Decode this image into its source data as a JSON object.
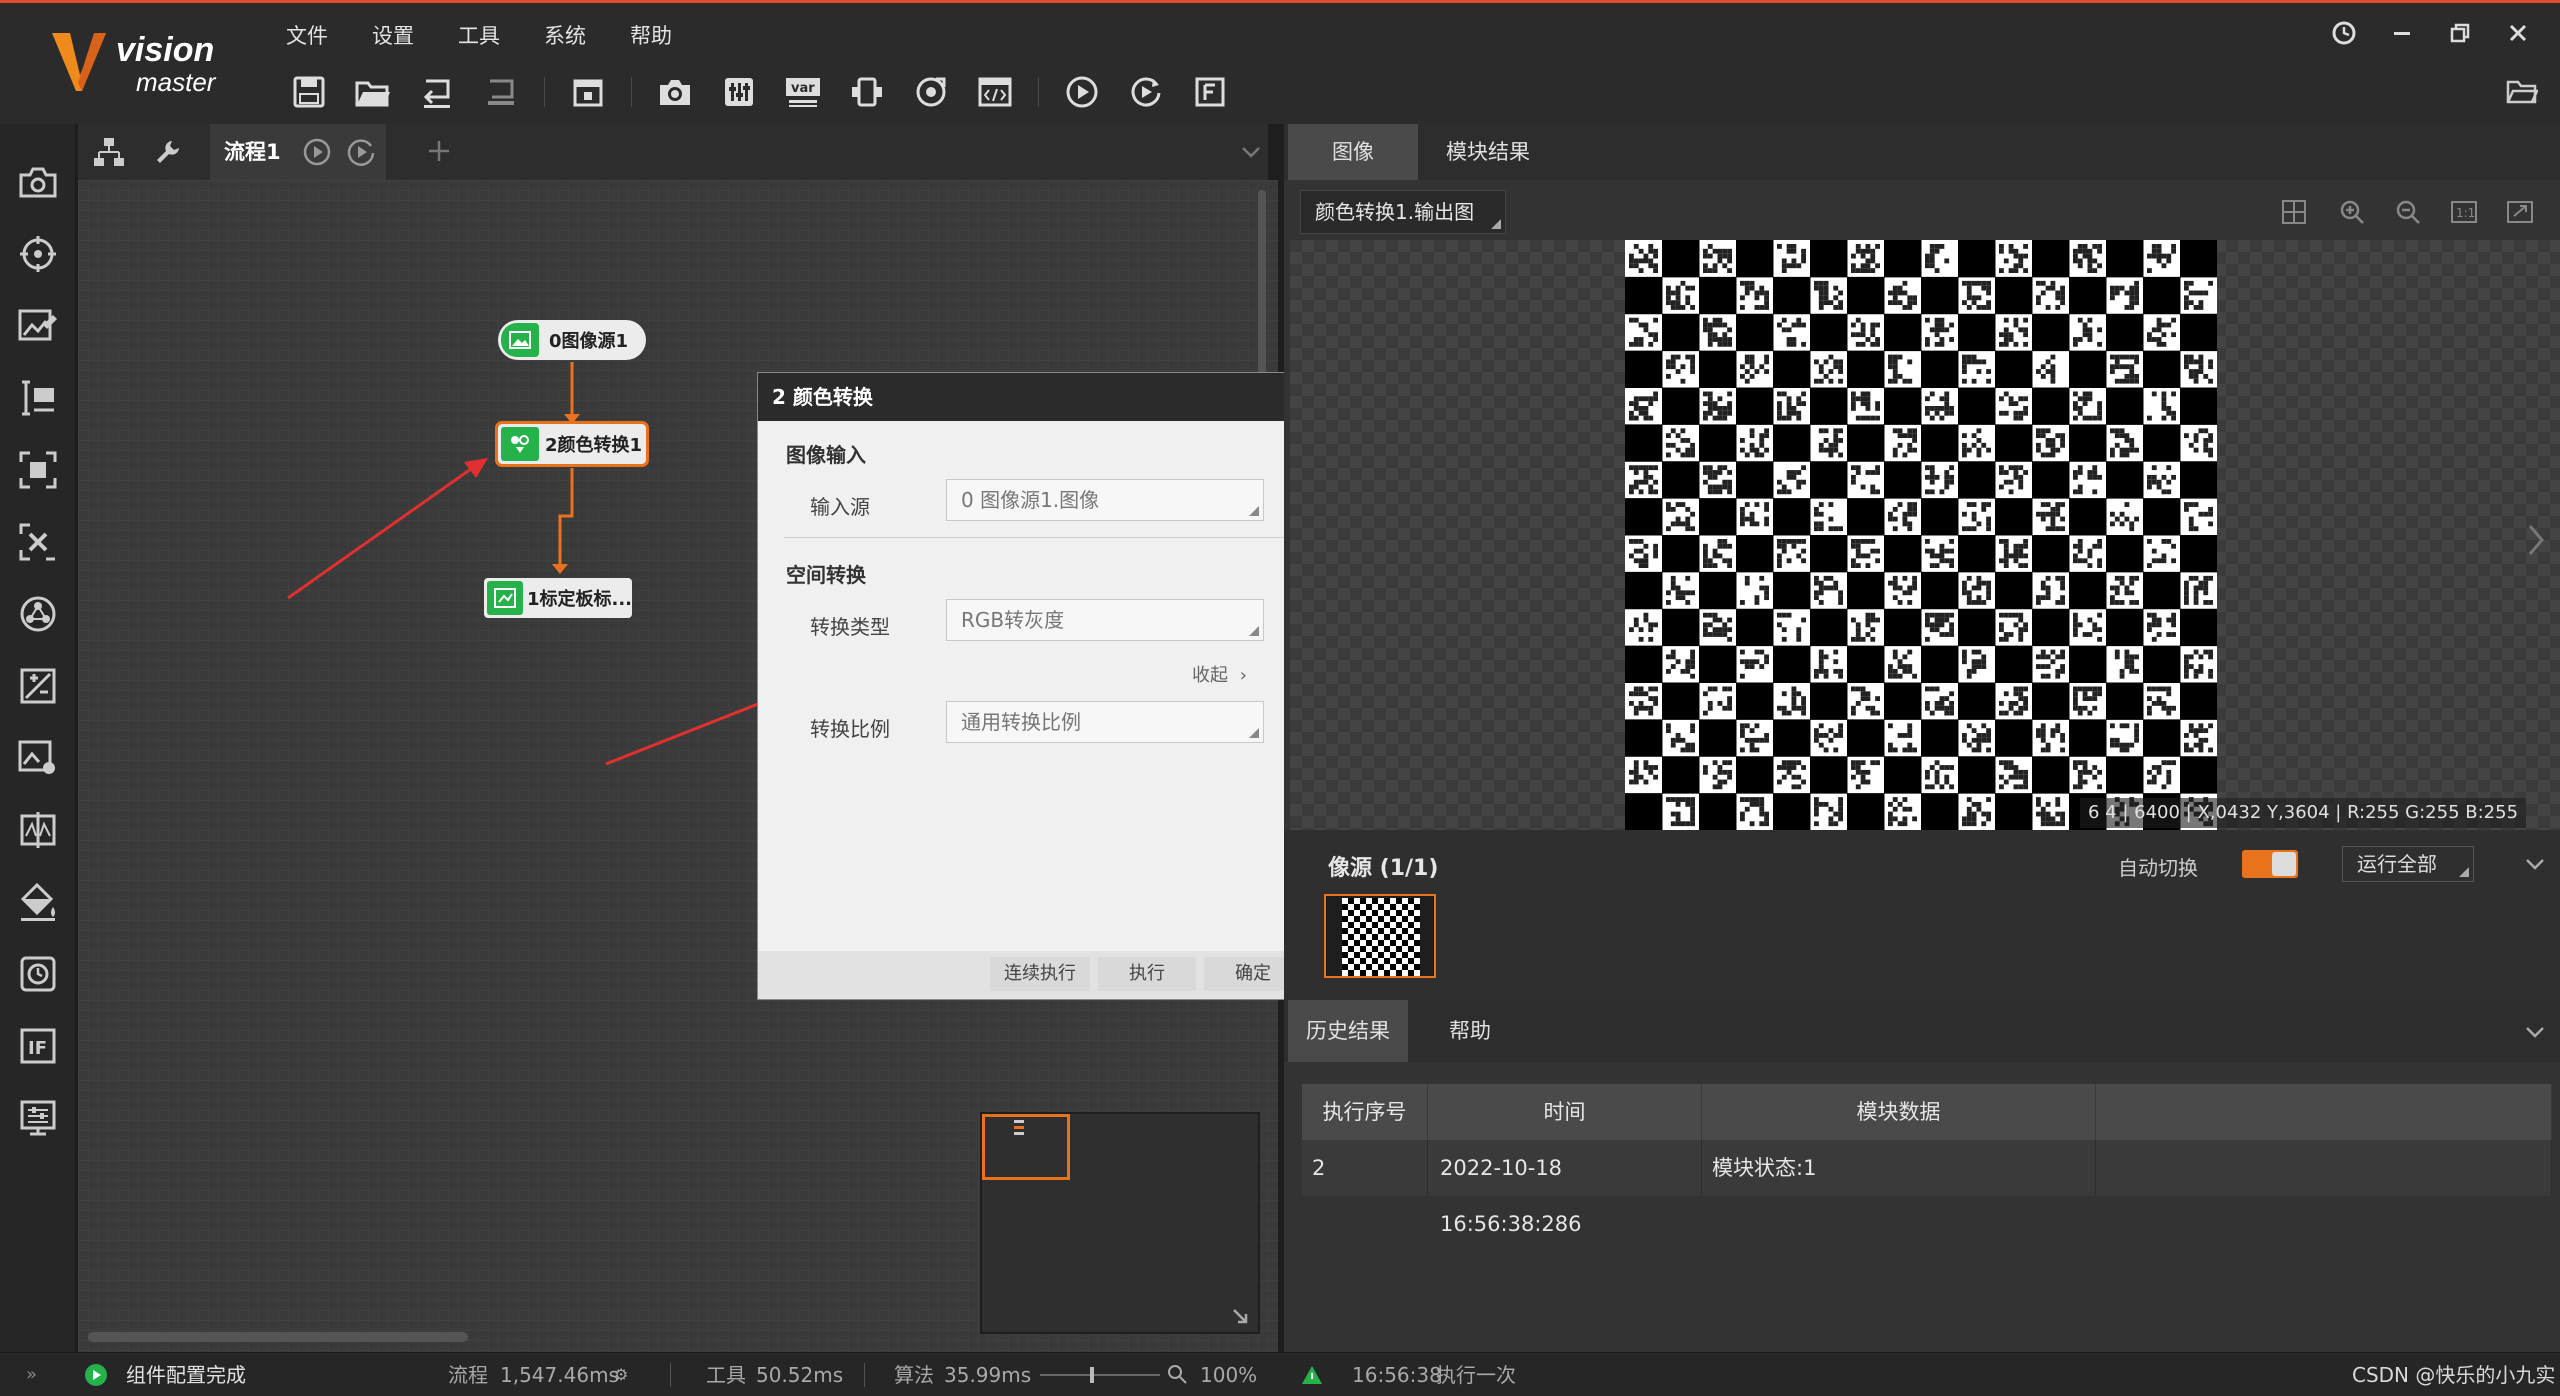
{
  "app": {
    "logo_main": "vision",
    "logo_sub": "master",
    "menu": [
      "文件",
      "设置",
      "工具",
      "系统",
      "帮助"
    ]
  },
  "toolbar": {
    "icons": [
      "save-icon",
      "open-folder-icon",
      "import-icon",
      "export-icon",
      "lock-icon",
      "camera-icon",
      "controller-icon",
      "variable-icon",
      "communication-icon",
      "global-trigger-icon",
      "script-icon",
      "run-once-icon",
      "run-loop-icon",
      "fonts-icon"
    ]
  },
  "sidebar": {
    "icons": [
      "camera-icon",
      "location-icon",
      "measure-icon",
      "recognition-icon",
      "calibration-icon",
      "alignment-icon",
      "image-process-icon",
      "color-process-icon",
      "defect-icon",
      "logic-icon",
      "paint-icon",
      "communication-icon",
      "if-icon",
      "system-icon"
    ]
  },
  "flow": {
    "tab_label": "流程1",
    "nodes": [
      {
        "label": "0图像源1"
      },
      {
        "label": "2颜色转换1"
      },
      {
        "label": "1标定板标..."
      }
    ]
  },
  "dialog": {
    "title": "2 颜色转换",
    "section1": "图像输入",
    "input_label": "输入源",
    "input_value": "0 图像源1.图像",
    "section2": "空间转换",
    "type_label": "转换类型",
    "type_value": "RGB转灰度",
    "collapse_label": "收起",
    "ratio_label": "转换比例",
    "ratio_value": "通用转换比例",
    "btn_continuous": "连续执行",
    "btn_execute": "执行",
    "btn_ok": "确定"
  },
  "right_panel": {
    "tabs": [
      "图像",
      "模块结果"
    ],
    "image_select": "颜色转换1.输出图",
    "pixel_info": "6 4 | 6400 | X,0432  Y,3604  |  R:255  G:255  B:255",
    "thumb_title": "像源 (1/1)",
    "auto_switch_label": "自动切换",
    "run_all_label": "运行全部"
  },
  "history": {
    "tabs": [
      "历史结果",
      "帮助"
    ],
    "headers": [
      "执行序号",
      "时间",
      "模块数据",
      ""
    ],
    "rows": [
      {
        "index": "2",
        "time": "2022-10-18 16:56:38:286",
        "data": "模块状态:1"
      }
    ]
  },
  "status": {
    "message": "组件配置完成",
    "flow_label": "流程",
    "flow_time": "1,547.46ms",
    "tool_label": "工具",
    "tool_time": "50.52ms",
    "algo_label": "算法",
    "algo_time": "35.99ms",
    "zoom": "100%",
    "right_time": "16:56:38",
    "right_msg": "执行一次",
    "watermark": "CSDN @快乐的小九实"
  },
  "colors": {
    "accent": "#e8731c",
    "node_green": "#26b24a",
    "top_border": "#e04b2f"
  }
}
